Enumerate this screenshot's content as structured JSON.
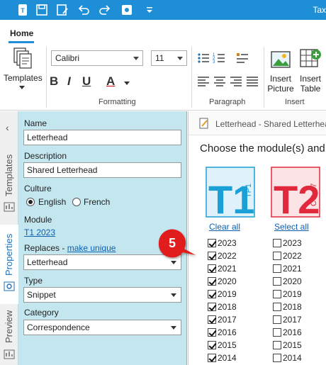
{
  "titlebar": {
    "title": "Tax"
  },
  "ribbon": {
    "tab_home": "Home",
    "templates_label": "Templates",
    "font_name": "Calibri",
    "font_size": "11",
    "group_formatting": "Formatting",
    "group_paragraph": "Paragraph",
    "group_insert": "Insert",
    "insert_picture": [
      "Insert",
      "Picture"
    ],
    "insert_table": [
      "Insert",
      "Table"
    ],
    "bold": "B",
    "italic": "I",
    "underline": "U",
    "font_color": "A"
  },
  "vtabs": {
    "templates": "Templates",
    "properties": "Properties",
    "preview": "Preview"
  },
  "props": {
    "name_label": "Name",
    "name_value": "Letterhead",
    "description_label": "Description",
    "description_value": "Shared Letterhead",
    "culture_label": "Culture",
    "culture_options": [
      "English",
      "French"
    ],
    "culture_selected": "English",
    "module_label": "Module",
    "module_value": "T1 2023",
    "replaces_label": "Replaces - ",
    "make_unique": "make unique",
    "replaces_value": "Letterhead",
    "type_label": "Type",
    "type_value": "Snippet",
    "category_label": "Category",
    "category_value": "Correspondence"
  },
  "doc": {
    "title": "Letterhead - Shared Letterhead",
    "choose": "Choose the module(s) and",
    "module1": {
      "big": "T1",
      "small": "TP1",
      "color": "#1a9fd6",
      "link": "Clear all"
    },
    "module2": {
      "big": "T2",
      "small": "CO-17",
      "color": "#e0293c",
      "link": "Select all"
    },
    "years": [
      "2023",
      "2022",
      "2021",
      "2020",
      "2019",
      "2018",
      "2017",
      "2016",
      "2015",
      "2014"
    ],
    "col1_checked": [
      true,
      true,
      true,
      true,
      true,
      true,
      true,
      true,
      true,
      true
    ],
    "col2_checked": [
      false,
      false,
      false,
      false,
      false,
      false,
      false,
      false,
      false,
      false
    ]
  },
  "step_badge": "5",
  "colors": {
    "accent": "#1e8fd6",
    "panel": "#c4e6ee",
    "badge": "#e01b1b"
  }
}
